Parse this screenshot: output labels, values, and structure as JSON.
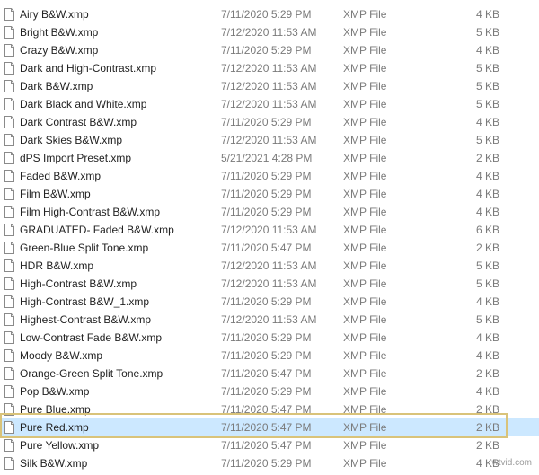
{
  "files": [
    {
      "name": "Airy B&W.xmp",
      "date": "7/11/2020 5:29 PM",
      "type": "XMP File",
      "size": "4 KB"
    },
    {
      "name": "Bright B&W.xmp",
      "date": "7/12/2020 11:53 AM",
      "type": "XMP File",
      "size": "5 KB"
    },
    {
      "name": "Crazy B&W.xmp",
      "date": "7/11/2020 5:29 PM",
      "type": "XMP File",
      "size": "4 KB"
    },
    {
      "name": "Dark and High-Contrast.xmp",
      "date": "7/12/2020 11:53 AM",
      "type": "XMP File",
      "size": "5 KB"
    },
    {
      "name": "Dark B&W.xmp",
      "date": "7/12/2020 11:53 AM",
      "type": "XMP File",
      "size": "5 KB"
    },
    {
      "name": "Dark Black and White.xmp",
      "date": "7/12/2020 11:53 AM",
      "type": "XMP File",
      "size": "5 KB"
    },
    {
      "name": "Dark Contrast B&W.xmp",
      "date": "7/11/2020 5:29 PM",
      "type": "XMP File",
      "size": "4 KB"
    },
    {
      "name": "Dark Skies B&W.xmp",
      "date": "7/12/2020 11:53 AM",
      "type": "XMP File",
      "size": "5 KB"
    },
    {
      "name": "dPS Import Preset.xmp",
      "date": "5/21/2021 4:28 PM",
      "type": "XMP File",
      "size": "2 KB"
    },
    {
      "name": "Faded B&W.xmp",
      "date": "7/11/2020 5:29 PM",
      "type": "XMP File",
      "size": "4 KB"
    },
    {
      "name": "Film B&W.xmp",
      "date": "7/11/2020 5:29 PM",
      "type": "XMP File",
      "size": "4 KB"
    },
    {
      "name": "Film High-Contrast B&W.xmp",
      "date": "7/11/2020 5:29 PM",
      "type": "XMP File",
      "size": "4 KB"
    },
    {
      "name": "GRADUATED- Faded B&W.xmp",
      "date": "7/12/2020 11:53 AM",
      "type": "XMP File",
      "size": "6 KB"
    },
    {
      "name": "Green-Blue Split Tone.xmp",
      "date": "7/11/2020 5:47 PM",
      "type": "XMP File",
      "size": "2 KB"
    },
    {
      "name": "HDR B&W.xmp",
      "date": "7/12/2020 11:53 AM",
      "type": "XMP File",
      "size": "5 KB"
    },
    {
      "name": "High-Contrast B&W.xmp",
      "date": "7/12/2020 11:53 AM",
      "type": "XMP File",
      "size": "5 KB"
    },
    {
      "name": "High-Contrast B&W_1.xmp",
      "date": "7/11/2020 5:29 PM",
      "type": "XMP File",
      "size": "4 KB"
    },
    {
      "name": "Highest-Contrast B&W.xmp",
      "date": "7/12/2020 11:53 AM",
      "type": "XMP File",
      "size": "5 KB"
    },
    {
      "name": "Low-Contrast Fade B&W.xmp",
      "date": "7/11/2020 5:29 PM",
      "type": "XMP File",
      "size": "4 KB"
    },
    {
      "name": "Moody B&W.xmp",
      "date": "7/11/2020 5:29 PM",
      "type": "XMP File",
      "size": "4 KB"
    },
    {
      "name": "Orange-Green Split Tone.xmp",
      "date": "7/11/2020 5:47 PM",
      "type": "XMP File",
      "size": "2 KB"
    },
    {
      "name": "Pop B&W.xmp",
      "date": "7/11/2020 5:29 PM",
      "type": "XMP File",
      "size": "4 KB"
    },
    {
      "name": "Pure Blue.xmp",
      "date": "7/11/2020 5:47 PM",
      "type": "XMP File",
      "size": "2 KB"
    },
    {
      "name": "Pure Red.xmp",
      "date": "7/11/2020 5:47 PM",
      "type": "XMP File",
      "size": "2 KB",
      "selected": true
    },
    {
      "name": "Pure Yellow.xmp",
      "date": "7/11/2020 5:47 PM",
      "type": "XMP File",
      "size": "2 KB"
    },
    {
      "name": "Silk B&W.xmp",
      "date": "7/11/2020 5:29 PM",
      "type": "XMP File",
      "size": "4 KB"
    }
  ],
  "watermark": "wtvid.com",
  "colors": {
    "selection_bg": "#cce8ff",
    "highlight_frame": "#d9c37a",
    "secondary_text": "#7a7a7a"
  },
  "icons": {
    "file": "file-icon"
  }
}
